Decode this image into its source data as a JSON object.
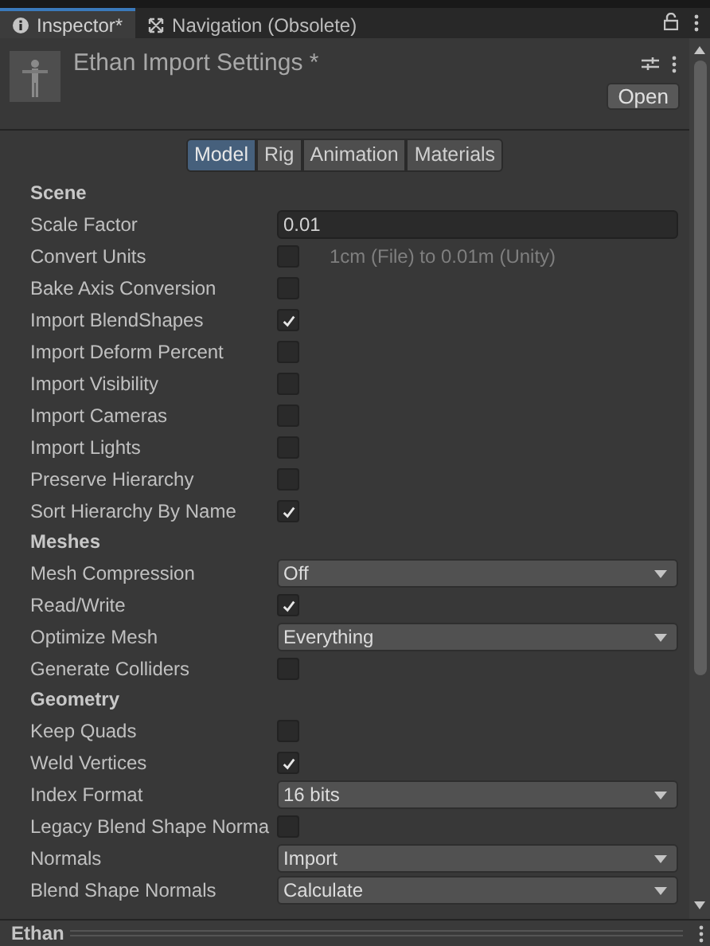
{
  "window_tabs": [
    {
      "label": "Inspector*",
      "selected": true
    },
    {
      "label": "Navigation (Obsolete)",
      "selected": false
    }
  ],
  "header": {
    "title": "Ethan Import Settings *",
    "open_button": "Open"
  },
  "importer_tabs": [
    {
      "label": "Model",
      "selected": true
    },
    {
      "label": "Rig",
      "selected": false
    },
    {
      "label": "Animation",
      "selected": false
    },
    {
      "label": "Materials",
      "selected": false
    }
  ],
  "sections": [
    {
      "title": "Scene",
      "rows": [
        {
          "kind": "field",
          "label": "Scale Factor",
          "value": "0.01"
        },
        {
          "kind": "checkbox",
          "label": "Convert Units",
          "checked": false,
          "note": "1cm (File) to 0.01m (Unity)"
        },
        {
          "kind": "checkbox",
          "label": "Bake Axis Conversion",
          "checked": false
        },
        {
          "kind": "checkbox",
          "label": "Import BlendShapes",
          "checked": true
        },
        {
          "kind": "checkbox",
          "label": "Import Deform Percent",
          "checked": false
        },
        {
          "kind": "checkbox",
          "label": "Import Visibility",
          "checked": false
        },
        {
          "kind": "checkbox",
          "label": "Import Cameras",
          "checked": false
        },
        {
          "kind": "checkbox",
          "label": "Import Lights",
          "checked": false
        },
        {
          "kind": "checkbox",
          "label": "Preserve Hierarchy",
          "checked": false
        },
        {
          "kind": "checkbox",
          "label": "Sort Hierarchy By Name",
          "checked": true
        }
      ]
    },
    {
      "title": "Meshes",
      "rows": [
        {
          "kind": "dropdown",
          "label": "Mesh Compression",
          "value": "Off"
        },
        {
          "kind": "checkbox",
          "label": "Read/Write",
          "checked": true
        },
        {
          "kind": "dropdown",
          "label": "Optimize Mesh",
          "value": "Everything"
        },
        {
          "kind": "checkbox",
          "label": "Generate Colliders",
          "checked": false
        }
      ]
    },
    {
      "title": "Geometry",
      "rows": [
        {
          "kind": "checkbox",
          "label": "Keep Quads",
          "checked": false
        },
        {
          "kind": "checkbox",
          "label": "Weld Vertices",
          "checked": true
        },
        {
          "kind": "dropdown",
          "label": "Index Format",
          "value": "16 bits"
        },
        {
          "kind": "checkbox",
          "label": "Legacy Blend Shape Norma",
          "checked": false
        },
        {
          "kind": "dropdown",
          "label": "Normals",
          "value": "Import"
        },
        {
          "kind": "dropdown",
          "label": "Blend Shape Normals",
          "value": "Calculate"
        }
      ]
    }
  ],
  "footer": {
    "title": "Ethan"
  }
}
